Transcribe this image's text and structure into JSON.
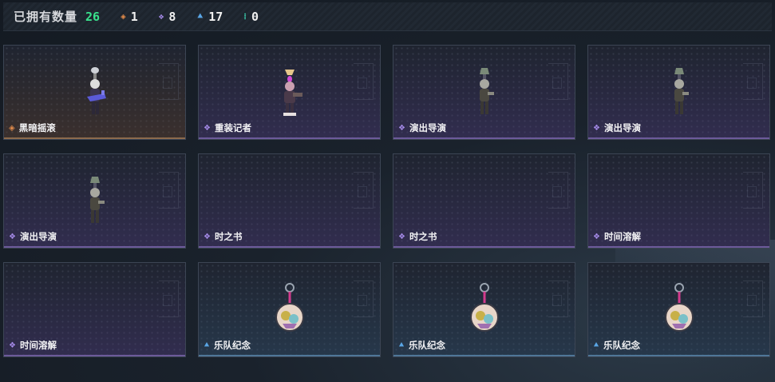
{
  "header": {
    "owned_label": "已拥有数量",
    "owned_count": "26",
    "stats": [
      {
        "icon": "orange-gem-icon",
        "value": "1"
      },
      {
        "icon": "purple-gem-icon",
        "value": "8"
      },
      {
        "icon": "blue-gem-icon",
        "value": "17"
      },
      {
        "icon": "teal-gem-icon",
        "value": "0"
      }
    ]
  },
  "colors": {
    "owned_count": "#39e08c",
    "orange": "#e08a4a",
    "purple": "#a58ae8",
    "blue": "#5aa6e6",
    "teal": "#3cd0b0"
  },
  "items": [
    {
      "name": "黑暗摇滚",
      "rarity": "orange",
      "art": "rocker-figure-icon"
    },
    {
      "name": "重装记者",
      "rarity": "purple",
      "art": "reporter-figure-icon"
    },
    {
      "name": "演出导演",
      "rarity": "purple",
      "art": "director-figure-icon"
    },
    {
      "name": "演出导演",
      "rarity": "purple",
      "art": "director-figure-icon"
    },
    {
      "name": "演出导演",
      "rarity": "purple",
      "art": "director-figure-icon"
    },
    {
      "name": "时之书",
      "rarity": "purple",
      "art": ""
    },
    {
      "name": "时之书",
      "rarity": "purple",
      "art": ""
    },
    {
      "name": "时间溶解",
      "rarity": "purple",
      "art": ""
    },
    {
      "name": "时间溶解",
      "rarity": "purple",
      "art": ""
    },
    {
      "name": "乐队纪念",
      "rarity": "blue",
      "art": "band-charm-icon"
    },
    {
      "name": "乐队纪念",
      "rarity": "blue",
      "art": "band-charm-icon"
    },
    {
      "name": "乐队纪念",
      "rarity": "blue",
      "art": "band-charm-icon"
    }
  ]
}
